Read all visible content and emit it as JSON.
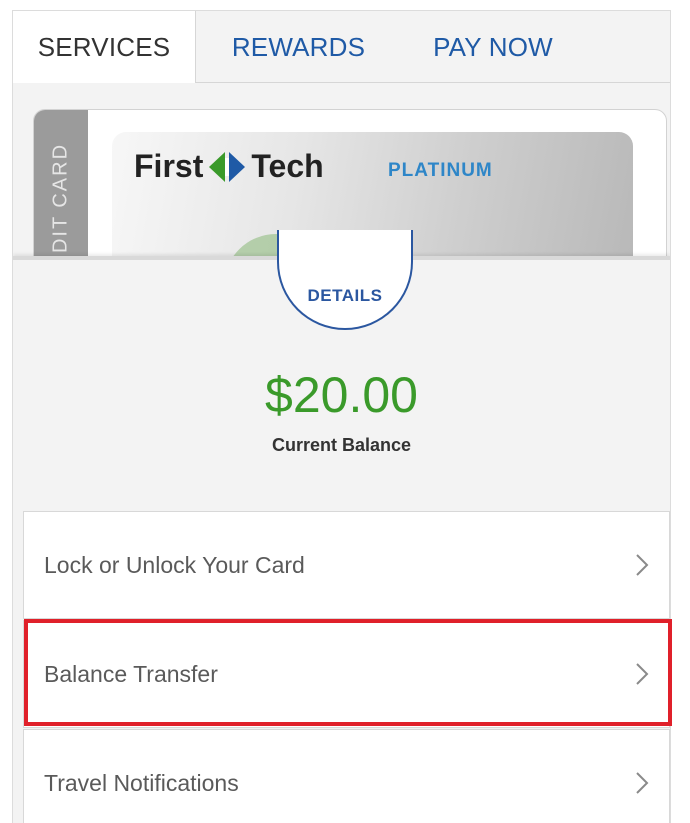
{
  "tabs": {
    "services": "SERVICES",
    "rewards": "REWARDS",
    "pay_now": "PAY NOW"
  },
  "card": {
    "side_label": "DIT CARD",
    "brand_first": "First",
    "brand_second": "Tech",
    "tier": "PLATINUM"
  },
  "details": {
    "label": "DETAILS"
  },
  "balance": {
    "amount": "$20.00",
    "label": "Current Balance"
  },
  "menu": {
    "items": [
      {
        "label": "Lock or Unlock Your Card"
      },
      {
        "label": "Balance Transfer"
      },
      {
        "label": "Travel Notifications"
      }
    ]
  },
  "colors": {
    "link_blue": "#1f5aa6",
    "balance_green": "#3a9a2a",
    "highlight_red": "#e0202a",
    "platinum_blue": "#2e86c8"
  },
  "icons": {
    "brand": "first-tech-diamond-icon",
    "chevron": "chevron-right-icon"
  }
}
